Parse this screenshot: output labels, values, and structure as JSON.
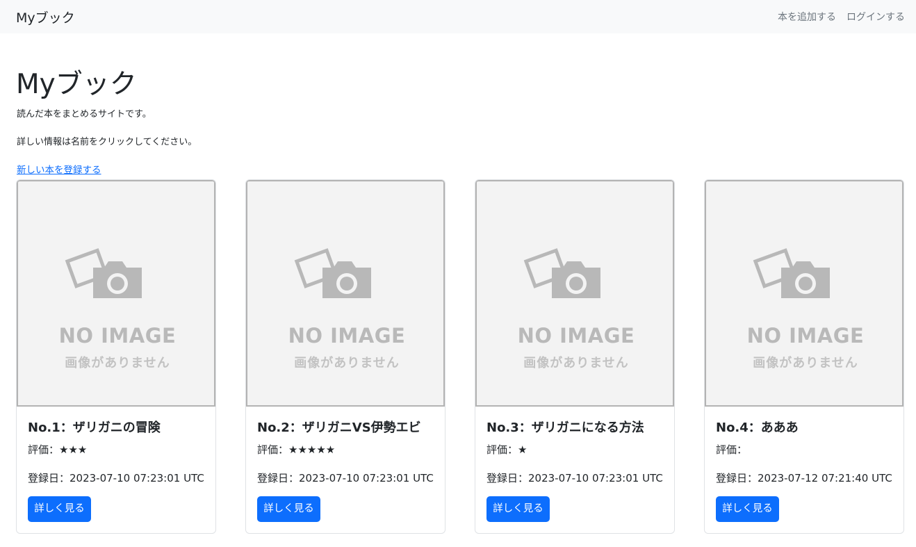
{
  "navbar": {
    "brand": "Myブック",
    "links": [
      "本を追加する",
      "ログインする"
    ]
  },
  "hero": {
    "title": "Myブック",
    "subtitle": "読んだ本をまとめるサイトです。",
    "hint": "詳しい情報は名前をクリックしてください。",
    "new_book_link": "新しい本を登録する"
  },
  "placeholder": {
    "title": "NO IMAGE",
    "subtitle": "画像がありません",
    "icon": "camera-photo-icon"
  },
  "books": [
    {
      "title": "No.1：ザリガニの冒険",
      "rating": "評価：★★★",
      "date": "登録日：2023-07-10 07:23:01 UTC",
      "button": "詳しく見る"
    },
    {
      "title": "No.2：ザリガニVS伊勢エビ",
      "rating": "評価：★★★★★",
      "date": "登録日：2023-07-10 07:23:01 UTC",
      "button": "詳しく見る"
    },
    {
      "title": "No.3：ザリガニになる方法",
      "rating": "評価：★",
      "date": "登録日：2023-07-10 07:23:01 UTC",
      "button": "詳しく見る"
    },
    {
      "title": "No.4：あああ",
      "rating": "評価：",
      "date": "登録日：2023-07-12 07:21:40 UTC",
      "button": "詳しく見る"
    }
  ],
  "colors": {
    "primary": "#0d6efd",
    "navbar_bg": "#f8f9fa",
    "placeholder_bg": "#f3f3f3",
    "placeholder_fg": "#b9b9b9"
  }
}
